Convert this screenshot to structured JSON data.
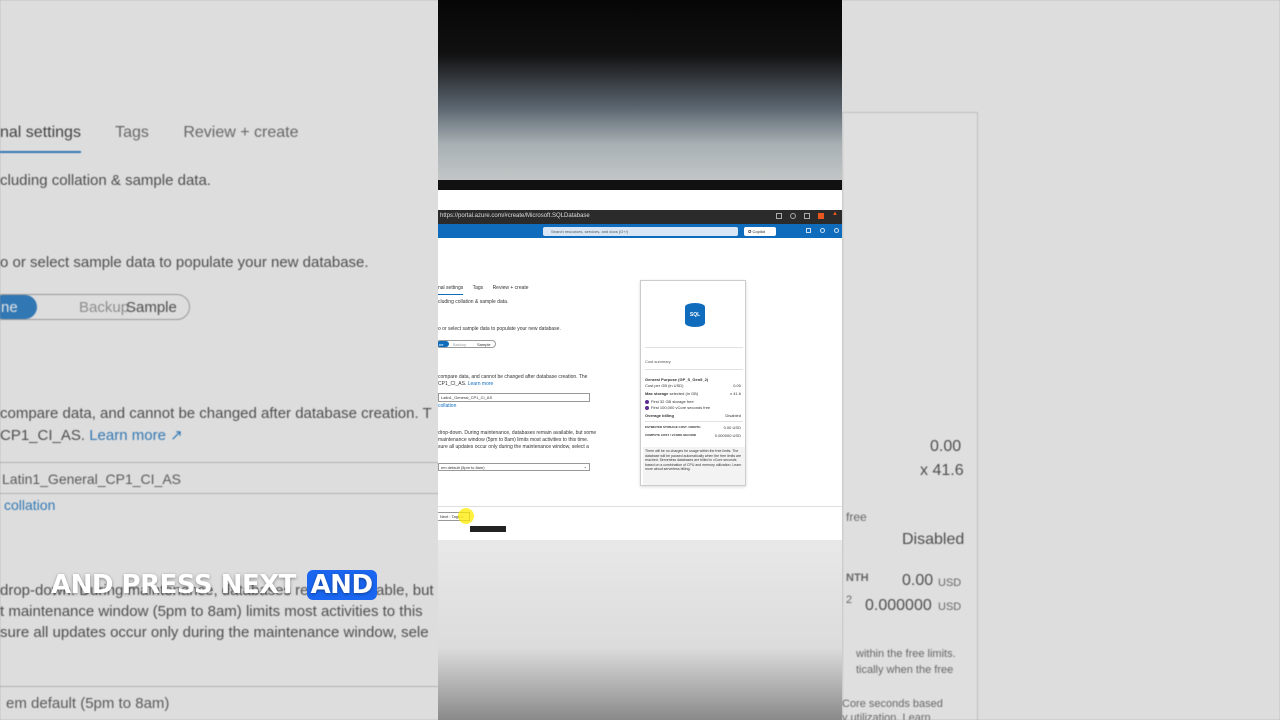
{
  "bg": {
    "tabs": [
      "nal settings",
      "Tags",
      "Review + create"
    ],
    "line1": "cluding collation & sample data.",
    "line2": "o or select sample data to populate your new database.",
    "toggle": [
      "ne",
      "Backup",
      "Sample"
    ],
    "line3": "compare data, and cannot be changed after database creation. T",
    "line4a": "CP1_CI_AS.",
    "line4b": "Learn more",
    "collation_value": "Latin1_General_CP1_CI_AS",
    "collation_link": "collation",
    "line5": "drop-down. During maintenance, databases remain available, but",
    "line6": "t maintenance window (5pm to 8am) limits most activities to this",
    "line7": "sure all updates occur only during the maintenance window, sele",
    "maint_value": "em default (5pm to 8am)",
    "right": {
      "v1": "0.00",
      "v2": "x 41.6",
      "free": "free",
      "disabled": "Disabled",
      "nth": "NTH",
      "v3": "0.00",
      "usd1": "USD",
      "v4": "0.000000",
      "usd2": "USD",
      "n2": "2",
      "t1": "within the free limits.",
      "t2": "tically when the free",
      "t3": "Core seconds based",
      "t4": "y utilization. Learn"
    }
  },
  "screen": {
    "url": "https://portal.azure.com/#create/Microsoft.SQLDatabase",
    "search_placeholder": "Search resources, services, and docs (G+/)",
    "copilot": "Copilot",
    "tabs": [
      "nal settings",
      "Tags",
      "Review + create"
    ],
    "line1": "cluding collation & sample data.",
    "line2": "o or select sample data to populate your new database.",
    "toggle": [
      "ne",
      "Backup",
      "Sample"
    ],
    "line3": "compare data, and cannot be changed after database creation. The",
    "line4": "CP1_CI_AS.",
    "line4_link": "Learn more",
    "collation_value": "Latin1_General_CP1_CI_AS",
    "collation_link": "collation",
    "line5": "drop-down. During maintenance, databases remain available, but some",
    "line6": "maintenance window (5pm to 8am) limits most activities to this time.",
    "line7": "sure all updates occur only during the maintenance window, select a",
    "maint_value": "em default (5pm to 8am)",
    "next_button": "Next : Tags >"
  },
  "summary": {
    "sql_label": "SQL",
    "title": "Cost summary",
    "tier": "General Purpose (GP_S_Gen5_2)",
    "cost_label": "Cost per GB (in USD)",
    "cost_value": "0.00",
    "max_storage_label": "Max storage",
    "max_storage_note": "selected (in GB)",
    "max_storage_value": "x 41.6",
    "free1": "First 32 GB storage free",
    "free2": "First 100,000 vCore seconds free",
    "overage_label": "Overage billing",
    "overage_value": "Disabled",
    "est_label": "ESTIMATED STORAGE COST / MONTH",
    "est_value": "0.00",
    "est_unit": "USD",
    "compute_label": "COMPUTE COST / VCORE SECOND",
    "compute_value": "0.000000",
    "compute_unit": "USD",
    "note": "There will be no charges for usage within the free limits. The database will be paused automatically when the free limits are reached. Serverless databases are billed in vCore seconds based on a combination of CPU and memory utilization. Learn more about serverless billing."
  },
  "caption": {
    "text": "AND PRESS NEXT",
    "highlight": "AND"
  }
}
